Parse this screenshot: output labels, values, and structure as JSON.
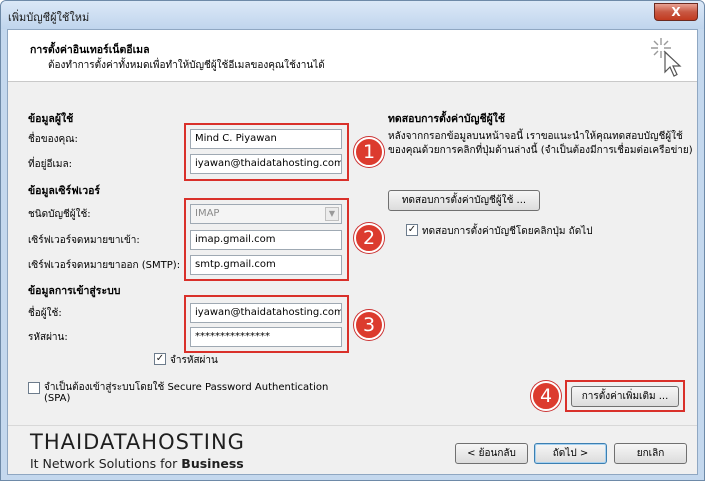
{
  "window": {
    "title": "เพิ่มบัญชีผู้ใช้ใหม่",
    "close_label": "X"
  },
  "header": {
    "title": "การตั้งค่าอินเทอร์เน็ตอีเมล",
    "subtitle": "ต้องทำการตั้งค่าทั้งหมดเพื่อทำให้บัญชีผู้ใช้อีเมลของคุณใช้งานได้",
    "icon": "wand-cursor-icon"
  },
  "user_info": {
    "section": "ข้อมูลผู้ใช้",
    "name_label": "ชื่อของคุณ:",
    "name_value": "Mind C. Piyawan",
    "email_label": "ที่อยู่อีเมล:",
    "email_value": "iyawan@thaidatahosting.com"
  },
  "server_info": {
    "section": "ข้อมูลเซิร์ฟเวอร์",
    "type_label": "ชนิดบัญชีผู้ใช้:",
    "type_value": "IMAP",
    "incoming_label": "เซิร์ฟเวอร์จดหมายขาเข้า:",
    "incoming_value": "imap.gmail.com",
    "outgoing_label": "เซิร์ฟเวอร์จดหมายขาออก (SMTP):",
    "outgoing_value": "smtp.gmail.com"
  },
  "logon_info": {
    "section": "ข้อมูลการเข้าสู่ระบบ",
    "user_label": "ชื่อผู้ใช้:",
    "user_value": "iyawan@thaidatahosting.com",
    "password_label": "รหัสผ่าน:",
    "password_value": "***************",
    "remember_label": "จำรหัสผ่าน",
    "remember_checked": "✓",
    "spa_label_1": "จำเป็นต้องเข้าสู่ระบบโดยใช้ Secure Password Authentication",
    "spa_label_2": "(SPA)"
  },
  "test": {
    "section": "ทดสอบการตั้งค่าบัญชีผู้ใช้",
    "description": "หลังจากกรอกข้อมูลบนหน้าจอนี้ เราขอแนะนำให้คุณทดสอบบัญชีผู้ใช้ของคุณด้วยการคลิกที่ปุ่มด้านล่างนี้ (จำเป็นต้องมีการเชื่อมต่อเครือข่าย)",
    "button": "ทดสอบการตั้งค่าบัญชีผู้ใช้ ...",
    "auto_label": "ทดสอบการตั้งค่าบัญชีโดยคลิกปุ่ม ถัดไป",
    "auto_checked": "✓"
  },
  "more_settings": "การตั้งค่าเพิ่มเติม ...",
  "badges": [
    "1",
    "2",
    "3",
    "4"
  ],
  "logo": {
    "line1": "THAIDATAHOSTING",
    "line2_a": "It Network Solutions for ",
    "line2_b": "Business"
  },
  "footer": {
    "back": "< ย้อนกลับ",
    "next": "ถัดไป >",
    "cancel": "ยกเลิก"
  },
  "colors": {
    "annotation_red": "#d9302a"
  }
}
